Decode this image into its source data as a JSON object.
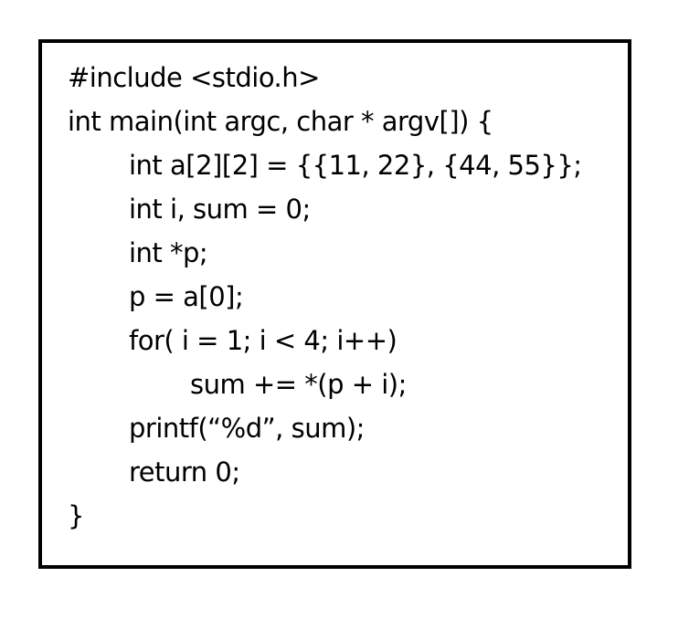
{
  "code": {
    "lines": [
      "#include <stdio.h>",
      "int main(int argc, char * argv[]) {",
      "int a[2][2] = {{11, 22}, {44, 55}};",
      "int i, sum = 0;",
      "int *p;",
      "p = a[0];",
      "for( i = 1; i < 4; i++)",
      "sum += *(p + i);",
      "printf(“%d”, sum);",
      "return 0;",
      "}"
    ]
  }
}
